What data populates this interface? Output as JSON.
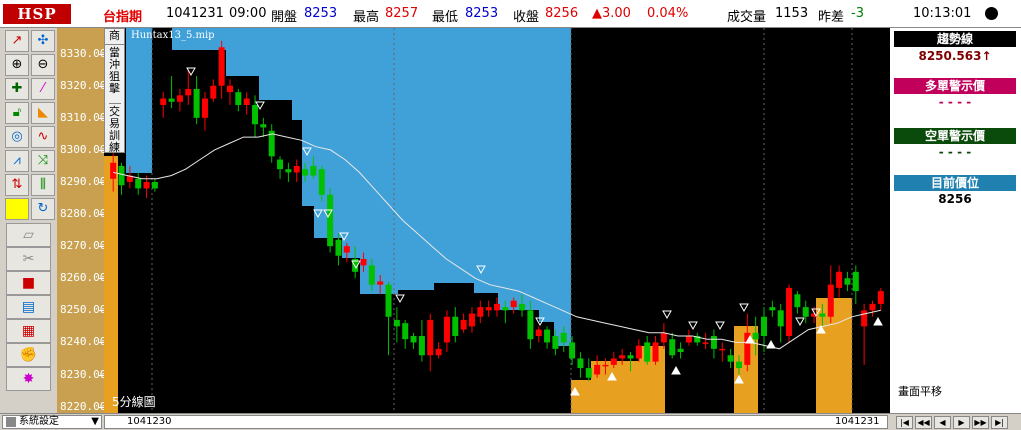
{
  "header": {
    "logo": "HSP",
    "symbol": "台指期",
    "date": "1041231",
    "time": "09:00",
    "open_label": "開盤",
    "open_value": "8253",
    "high_label": "最高",
    "high_value": "8257",
    "low_label": "最低",
    "low_value": "8253",
    "close_label": "收盤",
    "close_value": "8256",
    "change": "▲3.00",
    "change_pct": "0.04%",
    "volume_label": "成交量",
    "volume_value": "1153",
    "diff_label": "昨差",
    "diff_value": "-3",
    "clock": "10:13:01"
  },
  "side_tabs": [
    "商",
    "當沖狙擊",
    "交易訓練"
  ],
  "indicator_label": "Huntax13_5.mip",
  "period_label": "5分線圖",
  "y_axis": [
    "8330.00",
    "8320.00",
    "8310.00",
    "8300.00",
    "8290.00",
    "8280.00",
    "8270.00",
    "8260.00",
    "8250.00",
    "8240.00",
    "8230.00",
    "8220.00"
  ],
  "right_panel": {
    "trend_title": "趨勢線",
    "trend_value": "8250.563↑",
    "long_title": "多單警示價",
    "long_value": "- - - -",
    "short_title": "空單警示價",
    "short_value": "- - - -",
    "pos_title": "目前價位",
    "pos_value": "8256",
    "shift_label": "畫面平移"
  },
  "colors": {
    "up": "#ff0000",
    "down": "#00c000",
    "sky": "#40a0d8",
    "orange": "#e8a020",
    "trend_title": "#000000",
    "long_title": "#c0005a",
    "short_title": "#0a4a0a",
    "pos_title": "#2080b0"
  },
  "bottom": {
    "settings": "系統設定",
    "start_date": "1041230",
    "end_date": "1041231"
  },
  "chart_data": {
    "type": "candlestick",
    "ylim": [
      8218,
      8338
    ],
    "candles": [
      {
        "o": 8291,
        "c": 8296,
        "h": 8299,
        "l": 8287
      },
      {
        "o": 8295,
        "c": 8289,
        "h": 8296,
        "l": 8286
      },
      {
        "o": 8290,
        "c": 8292,
        "h": 8295,
        "l": 8288
      },
      {
        "o": 8291,
        "c": 8288,
        "h": 8293,
        "l": 8286
      },
      {
        "o": 8288,
        "c": 8290,
        "h": 8292,
        "l": 8285
      },
      {
        "o": 8290,
        "c": 8288,
        "h": 8291,
        "l": 8287
      },
      {
        "o": 8314,
        "c": 8316,
        "h": 8318,
        "l": 8310
      },
      {
        "o": 8316,
        "c": 8315,
        "h": 8323,
        "l": 8313
      },
      {
        "o": 8315,
        "c": 8317,
        "h": 8319,
        "l": 8312
      },
      {
        "o": 8317,
        "c": 8319,
        "h": 8325,
        "l": 8314
      },
      {
        "o": 8319,
        "c": 8310,
        "h": 8323,
        "l": 8308
      },
      {
        "o": 8310,
        "c": 8316,
        "h": 8318,
        "l": 8306
      },
      {
        "o": 8316,
        "c": 8320,
        "h": 8322,
        "l": 8315
      },
      {
        "o": 8320,
        "c": 8332,
        "h": 8334,
        "l": 8316
      },
      {
        "o": 8318,
        "c": 8320,
        "h": 8322,
        "l": 8314
      },
      {
        "o": 8318,
        "c": 8314,
        "h": 8319,
        "l": 8312
      },
      {
        "o": 8314,
        "c": 8316,
        "h": 8318,
        "l": 8311
      },
      {
        "o": 8314,
        "c": 8308,
        "h": 8317,
        "l": 8304
      },
      {
        "o": 8308,
        "c": 8307,
        "h": 8310,
        "l": 8304
      },
      {
        "o": 8306,
        "c": 8298,
        "h": 8308,
        "l": 8296
      },
      {
        "o": 8297,
        "c": 8294,
        "h": 8298,
        "l": 8291
      },
      {
        "o": 8294,
        "c": 8293,
        "h": 8296,
        "l": 8290
      },
      {
        "o": 8293,
        "c": 8295,
        "h": 8297,
        "l": 8290
      },
      {
        "o": 8294,
        "c": 8292,
        "h": 8296,
        "l": 8290
      },
      {
        "o": 8295,
        "c": 8292,
        "h": 8298,
        "l": 8291
      },
      {
        "o": 8294,
        "c": 8286,
        "h": 8295,
        "l": 8284
      },
      {
        "o": 8286,
        "c": 8270,
        "h": 8288,
        "l": 8268
      },
      {
        "o": 8272,
        "c": 8267,
        "h": 8274,
        "l": 8264
      },
      {
        "o": 8268,
        "c": 8270,
        "h": 8271,
        "l": 8265
      },
      {
        "o": 8266,
        "c": 8262,
        "h": 8270,
        "l": 8260
      },
      {
        "o": 8264,
        "c": 8266,
        "h": 8268,
        "l": 8262
      },
      {
        "o": 8264,
        "c": 8258,
        "h": 8266,
        "l": 8256
      },
      {
        "o": 8258,
        "c": 8259,
        "h": 8261,
        "l": 8255
      },
      {
        "o": 8258,
        "c": 8248,
        "h": 8259,
        "l": 8236
      },
      {
        "o": 8247,
        "c": 8245,
        "h": 8251,
        "l": 8240
      },
      {
        "o": 8246,
        "c": 8241,
        "h": 8247,
        "l": 8238
      },
      {
        "o": 8242,
        "c": 8240,
        "h": 8243,
        "l": 8238
      },
      {
        "o": 8242,
        "c": 8236,
        "h": 8247,
        "l": 8234
      },
      {
        "o": 8236,
        "c": 8247,
        "h": 8249,
        "l": 8231
      },
      {
        "o": 8236,
        "c": 8238,
        "h": 8240,
        "l": 8235
      },
      {
        "o": 8240,
        "c": 8248,
        "h": 8250,
        "l": 8237
      },
      {
        "o": 8248,
        "c": 8242,
        "h": 8251,
        "l": 8240
      },
      {
        "o": 8244,
        "c": 8247,
        "h": 8249,
        "l": 8243
      },
      {
        "o": 8245,
        "c": 8249,
        "h": 8251,
        "l": 8243
      },
      {
        "o": 8248,
        "c": 8251,
        "h": 8253,
        "l": 8246
      },
      {
        "o": 8250,
        "c": 8251,
        "h": 8253,
        "l": 8248
      },
      {
        "o": 8250,
        "c": 8252,
        "h": 8254,
        "l": 8248
      },
      {
        "o": 8251,
        "c": 8250,
        "h": 8253,
        "l": 8246
      },
      {
        "o": 8251,
        "c": 8253,
        "h": 8254,
        "l": 8249
      },
      {
        "o": 8252,
        "c": 8250,
        "h": 8255,
        "l": 8248
      },
      {
        "o": 8250,
        "c": 8241,
        "h": 8253,
        "l": 8238
      },
      {
        "o": 8242,
        "c": 8244,
        "h": 8245,
        "l": 8240
      },
      {
        "o": 8244,
        "c": 8240,
        "h": 8245,
        "l": 8238
      },
      {
        "o": 8242,
        "c": 8238,
        "h": 8244,
        "l": 8236
      },
      {
        "o": 8243,
        "c": 8240,
        "h": 8245,
        "l": 8237
      },
      {
        "o": 8240,
        "c": 8235,
        "h": 8242,
        "l": 8233
      },
      {
        "o": 8235,
        "c": 8232,
        "h": 8237,
        "l": 8229
      },
      {
        "o": 8232,
        "c": 8229,
        "h": 8235,
        "l": 8228
      },
      {
        "o": 8230,
        "c": 8233,
        "h": 8236,
        "l": 8229
      },
      {
        "o": 8233,
        "c": 8233,
        "h": 8235,
        "l": 8230
      },
      {
        "o": 8233,
        "c": 8235,
        "h": 8237,
        "l": 8232
      },
      {
        "o": 8235,
        "c": 8236,
        "h": 8238,
        "l": 8233
      },
      {
        "o": 8236,
        "c": 8235,
        "h": 8237,
        "l": 8231
      },
      {
        "o": 8235,
        "c": 8239,
        "h": 8241,
        "l": 8234
      },
      {
        "o": 8240,
        "c": 8234,
        "h": 8242,
        "l": 8233
      },
      {
        "o": 8234,
        "c": 8240,
        "h": 8242,
        "l": 8233
      },
      {
        "o": 8240,
        "c": 8243,
        "h": 8246,
        "l": 8238
      },
      {
        "o": 8241,
        "c": 8236,
        "h": 8243,
        "l": 8235
      },
      {
        "o": 8238,
        "c": 8237,
        "h": 8240,
        "l": 8235
      },
      {
        "o": 8240,
        "c": 8242,
        "h": 8244,
        "l": 8239
      },
      {
        "o": 8242,
        "c": 8240,
        "h": 8243,
        "l": 8239
      },
      {
        "o": 8240,
        "c": 8240,
        "h": 8243,
        "l": 8238
      },
      {
        "o": 8242,
        "c": 8238,
        "h": 8244,
        "l": 8235
      },
      {
        "o": 8238,
        "c": 8238,
        "h": 8240,
        "l": 8234
      },
      {
        "o": 8236,
        "c": 8234,
        "h": 8238,
        "l": 8232
      },
      {
        "o": 8234,
        "c": 8232,
        "h": 8236,
        "l": 8230
      },
      {
        "o": 8233,
        "c": 8243,
        "h": 8249,
        "l": 8231
      },
      {
        "o": 8243,
        "c": 8241,
        "h": 8248,
        "l": 8236
      },
      {
        "o": 8248,
        "c": 8242,
        "h": 8251,
        "l": 8237
      },
      {
        "o": 8251,
        "c": 8250,
        "h": 8253,
        "l": 8248
      },
      {
        "o": 8250,
        "c": 8245,
        "h": 8252,
        "l": 8240
      },
      {
        "o": 8242,
        "c": 8257,
        "h": 8258,
        "l": 8240
      },
      {
        "o": 8255,
        "c": 8251,
        "h": 8256,
        "l": 8249
      },
      {
        "o": 8251,
        "c": 8248,
        "h": 8253,
        "l": 8246
      },
      {
        "o": 8248,
        "c": 8249,
        "h": 8251,
        "l": 8246
      },
      {
        "o": 8249,
        "c": 8248,
        "h": 8252,
        "l": 8245
      },
      {
        "o": 8248,
        "c": 8258,
        "h": 8264,
        "l": 8246
      },
      {
        "o": 8257,
        "c": 8262,
        "h": 8264,
        "l": 8254
      },
      {
        "o": 8260,
        "c": 8258,
        "h": 8262,
        "l": 8256
      },
      {
        "o": 8262,
        "c": 8256,
        "h": 8264,
        "l": 8252
      },
      {
        "o": 8245,
        "c": 8250,
        "h": 8252,
        "l": 8233
      },
      {
        "o": 8250,
        "c": 8252,
        "h": 8253,
        "l": 8248
      },
      {
        "o": 8252,
        "c": 8256,
        "h": 8257,
        "l": 8250
      }
    ],
    "trend_line": [
      8293,
      8292,
      8291,
      8291,
      8292,
      8294,
      8297,
      8300,
      8302,
      8304,
      8304,
      8305,
      8304,
      8303,
      8301,
      8300,
      8297,
      8293,
      8288,
      8283,
      8278,
      8274,
      8270,
      8266,
      8263,
      8260,
      8258,
      8257,
      8256,
      8254,
      8252,
      8250,
      8248,
      8247,
      8246,
      8245,
      8244,
      8243,
      8243,
      8242,
      8242,
      8241,
      8241,
      8240,
      8240,
      8239,
      8238,
      8241,
      8244,
      8245,
      8246,
      8248,
      8249,
      8250
    ]
  }
}
